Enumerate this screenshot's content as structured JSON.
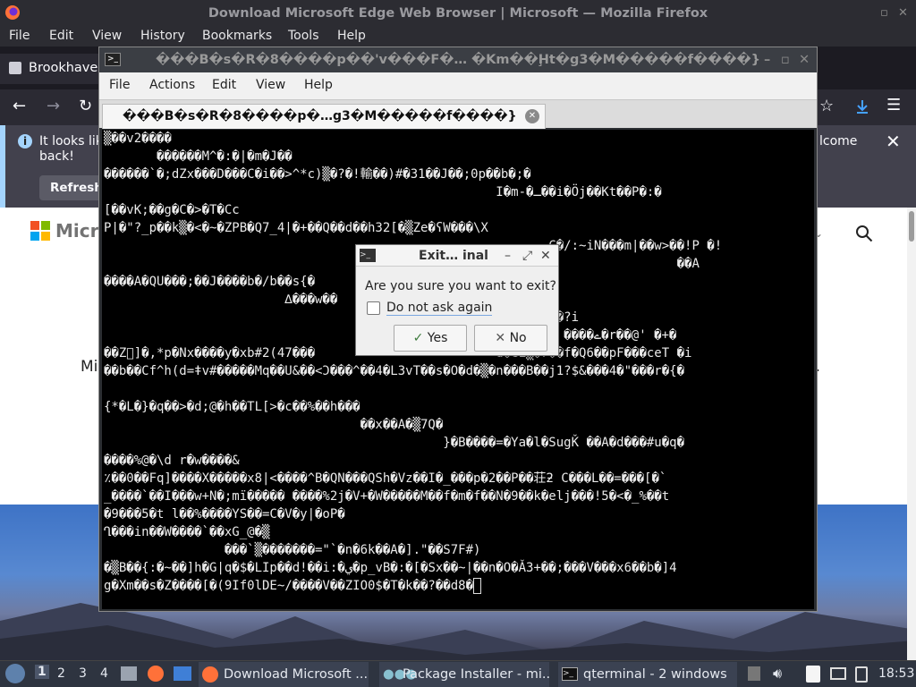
{
  "firefox": {
    "window_title": "Download Microsoft Edge Web Browser | Microsoft — Mozilla Firefox",
    "menu": [
      "File",
      "Edit",
      "View",
      "History",
      "Bookmarks",
      "Tools",
      "Help"
    ],
    "tab_label": "Brookhaven",
    "info_bar": {
      "text_start": "It looks lik",
      "text_line2": "back!",
      "text_end": "lcome",
      "refresh_label": "Refresh"
    },
    "page": {
      "logo_text": "Micro",
      "body_left": "Mi",
      "body_right": "y."
    }
  },
  "terminal": {
    "window_title": "���B�s�R�8����p��'v���F�… �Km��Ḩt�g3�M�����f����}",
    "menu": [
      "File",
      "Actions",
      "Edit",
      "View",
      "Help"
    ],
    "tab_label": "���B�s�R�8����p�…g3�M�����f����}",
    "lines": [
      "▒��v2����",
      "       ������M^�:�|�m�J��",
      "������`�;dZx���D���C�i��>^*c)▒�?�!輸��)#�31��J��;0p��b�;�",
      "                                                    I�m-�ـ��i�Öj��Kt��P�:�",
      "[��vK;��g�C�>�T�Cc",
      "P|�\"?_p��k▒�<�~�ZPB�Q7_4|�+��Q��d��h32[�▒Ze�ʕW���\\X",
      "                                                           C�/:~iN���m|��w>��!P �!",
      "                                                                            ��A",
      "����A�QU���;��J����b�/b��s{�",
      "                        ∆���w��",
      "                                                         �B��?i",
      "                                                             ����ے�r��@' �+�",
      "��Z⃞]�,*p�Nx����y�xb#2(47���                        d�GL▒�r��f�Q6��pF���ceT �i",
      "��b��Cf^h(d=ǂv#�����Mq��U&��<Ͻ���^��4�L3vT��s�O�d�▒�n���B��j1?$&���4�\"���r�{�",
      "",
      "{*�L�}�q��>�d;@�h��TL[>�c��%��h���",
      "                                  ��x��A�▒7Q�",
      "                                             }�B����=�Ya�l�SugǨ ��A�d���#u�q�",
      "����%@�\\d r�w����&",
      "٪��0��Fq]����X�����x8|<����^B�QN���QSh�Vz��I�_���p�2��P��荘ƻ C���L��=���[�`",
      "_����`��I���w+N�;mï����� ����%2j�V+�W�����M��f�m�f��N�9��k�elj���!5�<�_%��t",
      "�9���5�t l��%����YS��=C�V�y|�oP�",
      "Ղ���in��W����`��xG_@�▒",
      "                ���`▒�������=\"`�n�6k��A�].\"��S7F#)",
      "�▒B��{:�~��]h�G|q�$�LIp��d!��i:�ي�p_vB�:�[�Sx��~|��n�O�Ǎ3+��;���V���x6��b�]4",
      "g�Xm��s�Z����[�(9If0lDE~/����V��ZIO0$�T�k��?��d8�"
    ]
  },
  "dialog": {
    "title": "Exit… inal",
    "question": "Are you sure you want to exit?",
    "checkbox_label": "Do not ask again",
    "yes_label": "Yes",
    "no_label": "No"
  },
  "taskbar": {
    "workspaces": [
      "1",
      "2",
      "3",
      "4"
    ],
    "tasks": [
      "Download Microsoft ...",
      "Package Installer - mi...",
      "qterminal - 2 windows"
    ],
    "clock": "18:53"
  },
  "colors": {
    "accent_blue": "#a4d4fd",
    "download_icon": "#45a1ff",
    "taskbar_bg": "#2e3440"
  }
}
